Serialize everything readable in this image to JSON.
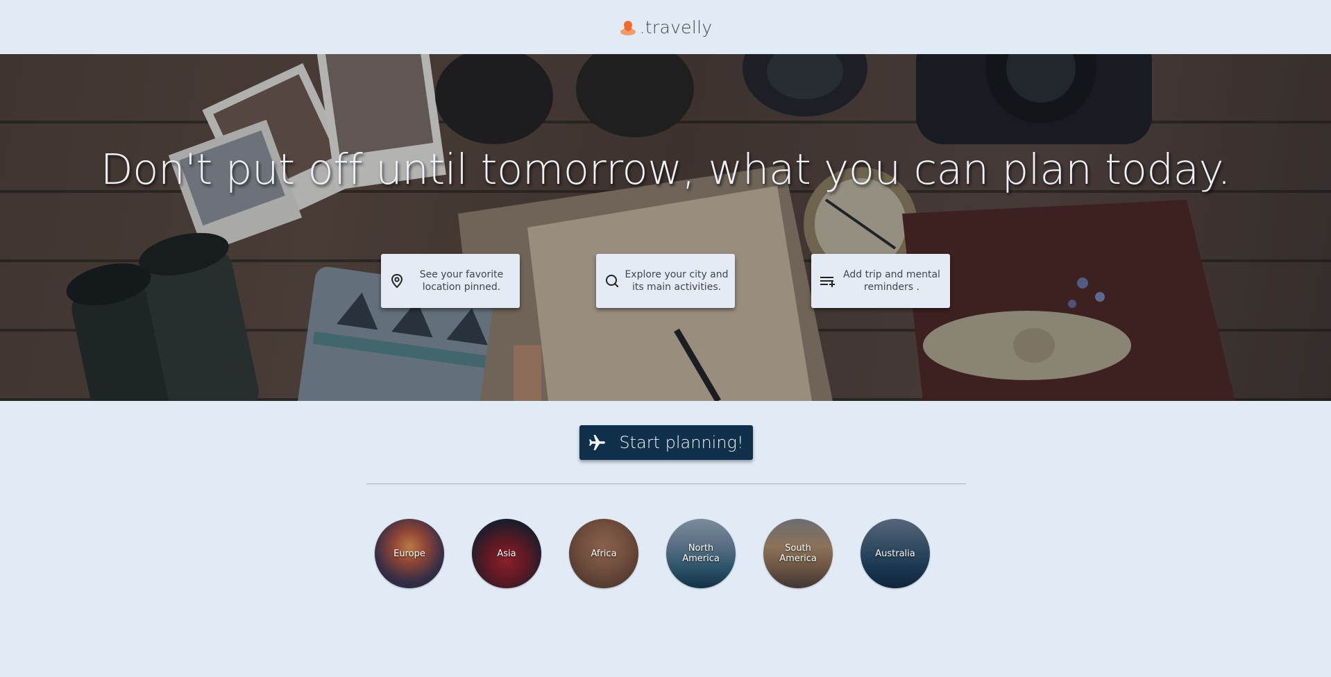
{
  "header": {
    "brand": ".travelly",
    "logo_icon": "map-pin-person-icon",
    "logo_color": "#ef6c2e"
  },
  "hero": {
    "title": "Don't put off until tomorrow, what you can plan today.",
    "features": [
      {
        "icon": "map-pin-icon",
        "text": "See your favorite location pinned."
      },
      {
        "icon": "search-icon",
        "text": "Explore your city and its main activities."
      },
      {
        "icon": "playlist-add-icon",
        "text": "Add trip and mental reminders ."
      }
    ]
  },
  "cta": {
    "label": "Start planning!",
    "icon": "airplane-icon",
    "color": "#0f2f4a"
  },
  "continents": [
    {
      "name": "Europe"
    },
    {
      "name": "Asia"
    },
    {
      "name": "Africa"
    },
    {
      "name": "North America"
    },
    {
      "name": "South America"
    },
    {
      "name": "Australia"
    }
  ]
}
